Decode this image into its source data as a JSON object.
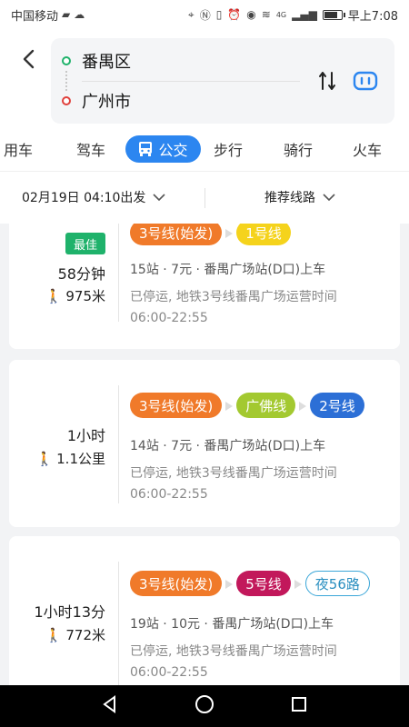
{
  "status_bar": {
    "carrier": "中国移动",
    "network": "4G",
    "time": "早上7:08",
    "battery_level": 0.85
  },
  "header": {
    "from": "番禺区",
    "to": "广州市",
    "icons": [
      "back-icon",
      "swap-icon",
      "more-icon"
    ]
  },
  "tabs": [
    {
      "label": "用车",
      "active": false
    },
    {
      "label": "驾车",
      "active": false
    },
    {
      "label": "公交",
      "active": true,
      "icon": "bus-icon"
    },
    {
      "label": "步行",
      "active": false
    },
    {
      "label": "骑行",
      "active": false
    },
    {
      "label": "火车",
      "active": false
    }
  ],
  "options": {
    "depart_time": "02月19日 04:10出发",
    "preference": "推荐线路"
  },
  "routes": [
    {
      "badge": "最佳",
      "duration": "58分钟",
      "walk": "975米",
      "lines": [
        {
          "label": "3号线(始发)",
          "color": "#f07a2a",
          "style": "solid"
        },
        {
          "label": "1号线",
          "color": "#f5d31c",
          "style": "solid"
        }
      ],
      "info": "15站 · 7元 · 番禺广场站(D口)上车",
      "note": "已停运, 地铁3号线番禺广场运营时间06:00-22:55"
    },
    {
      "duration": "1小时",
      "walk": "1.1公里",
      "lines": [
        {
          "label": "3号线(始发)",
          "color": "#f07a2a",
          "style": "solid"
        },
        {
          "label": "广佛线",
          "color": "#a3c930",
          "style": "solid"
        },
        {
          "label": "2号线",
          "color": "#2c6fd6",
          "style": "solid"
        }
      ],
      "info": "14站 · 7元 · 番禺广场站(D口)上车",
      "note": "已停运, 地铁3号线番禺广场运营时间06:00-22:55"
    },
    {
      "duration": "1小时13分",
      "walk": "772米",
      "lines": [
        {
          "label": "3号线(始发)",
          "color": "#f07a2a",
          "style": "solid"
        },
        {
          "label": "5号线",
          "color": "#c2185b",
          "style": "solid"
        },
        {
          "label": "夜56路",
          "color": "#3aa6d8",
          "style": "outline"
        }
      ],
      "info": "19站 · 10元 · 番禺广场站(D口)上车",
      "note": "已停运, 地铁3号线番禺广场运营时间06:00-22:55"
    }
  ],
  "nav": [
    "back-icon",
    "home-icon",
    "recents-icon"
  ]
}
